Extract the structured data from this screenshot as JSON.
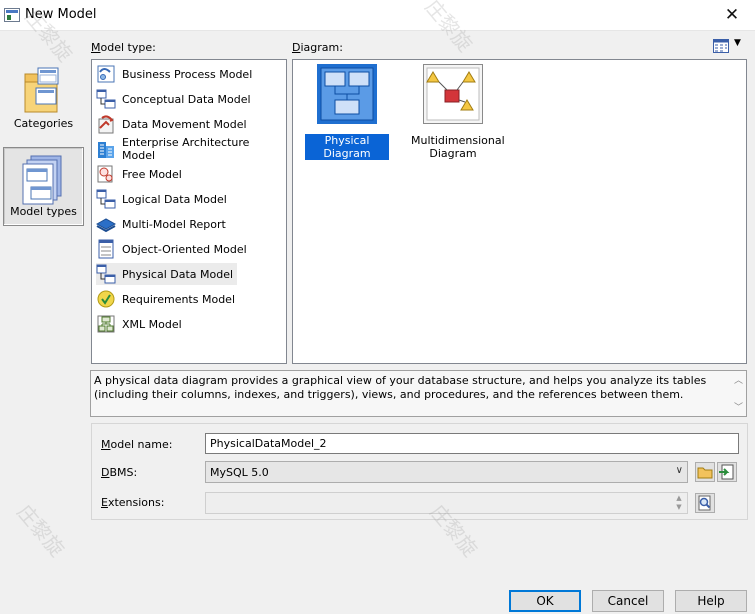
{
  "window": {
    "title": "New Model"
  },
  "sidebar": {
    "items": [
      {
        "label": "Categories"
      },
      {
        "label": "Model types",
        "selected": true
      }
    ]
  },
  "model_type": {
    "label": "Model type:",
    "items": [
      {
        "label": "Business Process Model",
        "icon": "business-process-model-icon"
      },
      {
        "label": "Conceptual Data Model",
        "icon": "conceptual-data-model-icon"
      },
      {
        "label": "Data Movement Model",
        "icon": "data-movement-model-icon"
      },
      {
        "label": "Enterprise Architecture Model",
        "icon": "enterprise-architecture-model-icon"
      },
      {
        "label": "Free Model",
        "icon": "free-model-icon"
      },
      {
        "label": "Logical Data Model",
        "icon": "logical-data-model-icon"
      },
      {
        "label": "Multi-Model Report",
        "icon": "multi-model-report-icon"
      },
      {
        "label": "Object-Oriented Model",
        "icon": "object-oriented-model-icon"
      },
      {
        "label": "Physical Data Model",
        "icon": "physical-data-model-icon",
        "selected": true
      },
      {
        "label": "Requirements Model",
        "icon": "requirements-model-icon"
      },
      {
        "label": "XML Model",
        "icon": "xml-model-icon"
      }
    ]
  },
  "diagram": {
    "label": "Diagram:",
    "items": [
      {
        "label": "Physical Diagram",
        "selected": true
      },
      {
        "label": "Multidimensional\nDiagram"
      }
    ]
  },
  "description": "A physical data diagram provides a graphical view of your database structure, and helps you analyze its tables (including their columns, indexes, and triggers), views, and procedures, and the references between them.",
  "form": {
    "model_name_label": "Model name:",
    "model_name_value": "PhysicalDataModel_2",
    "dbms_label": "DBMS:",
    "dbms_value": "MySQL 5.0",
    "extensions_label": "Extensions:"
  },
  "buttons": {
    "ok": "OK",
    "cancel": "Cancel",
    "help": "Help"
  },
  "watermark_text": "庄黎旋",
  "colors": {
    "selection": "#0a64d6",
    "default_button_border": "#0078d7"
  }
}
